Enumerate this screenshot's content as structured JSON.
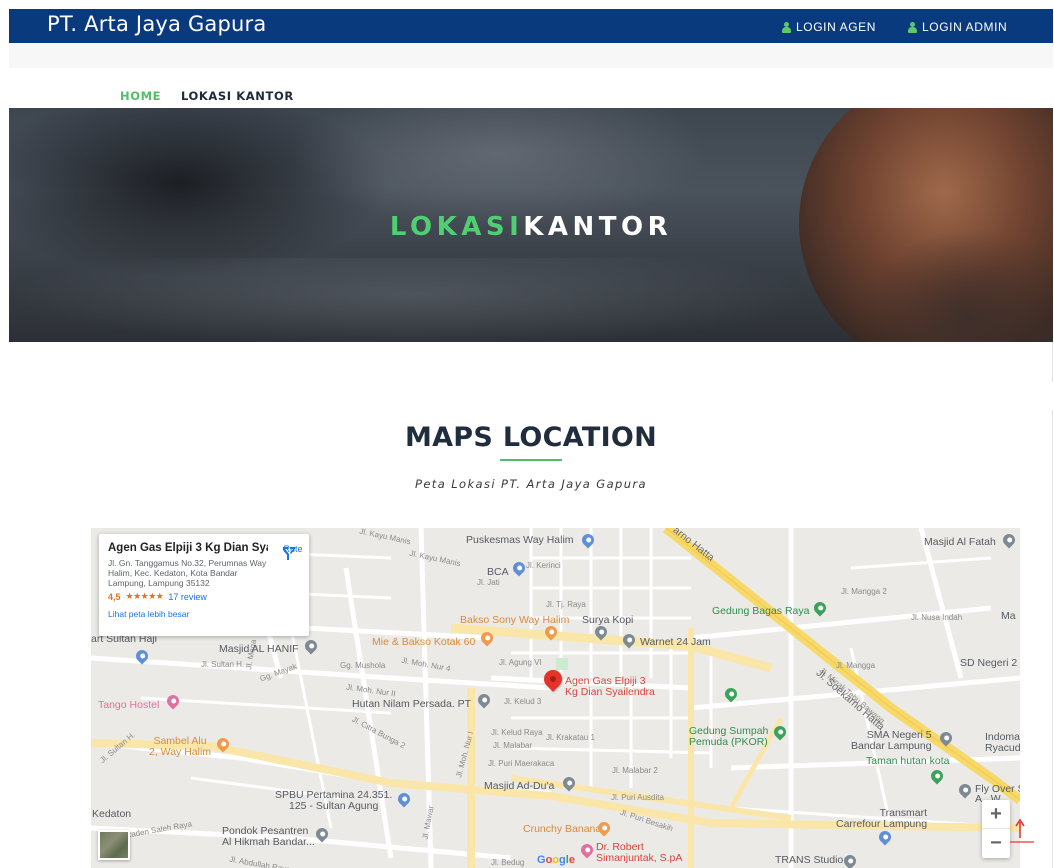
{
  "header": {
    "brand": "PT. Arta Jaya Gapura",
    "login_agen": "LOGIN AGEN",
    "login_admin": "LOGIN ADMIN",
    "icon": "user-icon"
  },
  "nav": {
    "items": [
      {
        "label": "HOME",
        "active": true
      },
      {
        "label": "LOKASI KANTOR",
        "active": false
      }
    ]
  },
  "hero": {
    "title_part1": "LOKASI",
    "title_part2": "KANTOR",
    "accent_color": "#4fcf72"
  },
  "section": {
    "title": "MAPS LOCATION",
    "subtitle": "Peta Lokasi PT. Arta Jaya Gapura"
  },
  "map": {
    "info_card": {
      "title": "Agen Gas Elpiji 3 Kg Dian Syai...",
      "address": "Jl. Gn. Tanggamus No.32, Perumnas Way Halim, Kec. Kedaton, Kota Bandar Lampung, Lampung 35132",
      "rating": "4,5",
      "stars": "★★★★★",
      "reviews": "17 review",
      "link": "Lihat peta lebih besar",
      "route_label": "Rute"
    },
    "marker_label_1": "Agen Gas Elpiji 3",
    "marker_label_2": "Kg Dian Syailendra",
    "places": {
      "puskesmas": "Puskesmas Way Halim",
      "bca": "BCA",
      "masjid_al_fatah": "Masjid Al Fatah",
      "gedung_bagas": "Gedung Bagas Raya",
      "bakso_sony": "Bakso Sony Way Halim",
      "surya_kopi": "Surya Kopi",
      "warnet": "Warnet 24 Jam",
      "mie_bakso": "Mie & Bakso Kotak 60",
      "masjid_al_hanif": "Masjid AL HANIF",
      "art_sultan": "art Sultan Haji",
      "sd_negeri": "SD Negeri 2",
      "tango": "Tango Hostel",
      "hutan_nilam": "Hutan Nilam Persada. PT",
      "gedung_sumpah_1": "Gedung Sumpah",
      "gedung_sumpah_2": "Pemuda (PKOR)",
      "sma_1": "SMA Negeri 5",
      "sma_2": "Bandar Lampung",
      "indoma": "Indoma",
      "ryacudu": "Ryacudu",
      "taman": "Taman hutan kota",
      "sambel_1": "Sambel Alu",
      "sambel_2": "2, Way Halim",
      "masjid_ad_du": "Masjid Ad-Du'a",
      "spbu_1": "SPBU Pertamina 24.351.",
      "spbu_2": "125 - Sultan Agung",
      "fly_over_1": "Fly Over S",
      "fly_over_2": "A",
      "fly_over_3": "W",
      "kedaton": "Kedaton",
      "transmart_1": "Transmart",
      "transmart_2": "Carrefour Lampung",
      "crunchy": "Crunchy Banana",
      "pondok_1": "Pondok Pesantren",
      "pondok_2": "Al Hikmah Bandar...",
      "dr_robert_1": "Dr. Robert",
      "dr_robert_2": "Simanjuntak, S.pA",
      "trans_studio": "TRANS Studio",
      "ma": "Ma"
    },
    "roads": {
      "soekarno_hatta_1": "Jl. Soekarno Hatta",
      "soekarno_hatta_2": "arno Hatta",
      "kayu_manis": "Jl. Kayu Manis",
      "kayu_manis_2": "Jl. Kayu Manis",
      "kerinci": "Jl. Kerinci",
      "jati": "Jl. Jati",
      "tj_raya": "Jl. Tj. Raya",
      "mangga_2": "Jl. Mangga 2",
      "mangga": "Jl. Mangga",
      "nusa_indah": "Jl. Nusa Indah",
      "moh_nur_4": "Jl. Moh. Nur 4",
      "moh_nur_ii": "Jl. Moh. Nur II",
      "agung_vi": "Jl. Agung VI",
      "kelud_3": "Jl. Kelud 3",
      "kelud_raya": "Jl. Kelud Raya",
      "krakatau": "Jl. Krakatau 1",
      "malabar": "Jl. Malabar",
      "malabar_2": "Jl. Malabar 2",
      "puri_maerakaca": "Jl. Puri Maerakaca",
      "puri_ausdita": "Jl. Puri Ausdita",
      "puri_besakih": "Jl. Puri Besakih",
      "citra_bunga": "Jl. Citra Bunga 2",
      "sultan_h": "Jl. Sultan H.",
      "sultan_h_2": "Jl. Sultan H.",
      "gg_mushola": "Gg. Mushola",
      "gg_mayak": "Gg. Mayak",
      "raden_saleh": "Jl. Raden Saleh Raya",
      "abdullah": "Jl. Abdullah Raya",
      "bedug": "Jl. Bedug",
      "minak_tebu": "Jl. Minak Tebu Bawang",
      "moh_nur_i": "Jl. Moh. Nur I",
      "mawar": "Jl. Mawar",
      "mega": "Jl. Mega"
    },
    "zoom_in": "+",
    "zoom_out": "−",
    "google": [
      "G",
      "o",
      "o",
      "g",
      "l",
      "e"
    ]
  },
  "colors": {
    "topbar": "#0a3a7e",
    "accent_green": "#4fbf6a",
    "map_road_yellow": "#f6d96a"
  },
  "scroll_top_icon": "arrow-up-icon"
}
